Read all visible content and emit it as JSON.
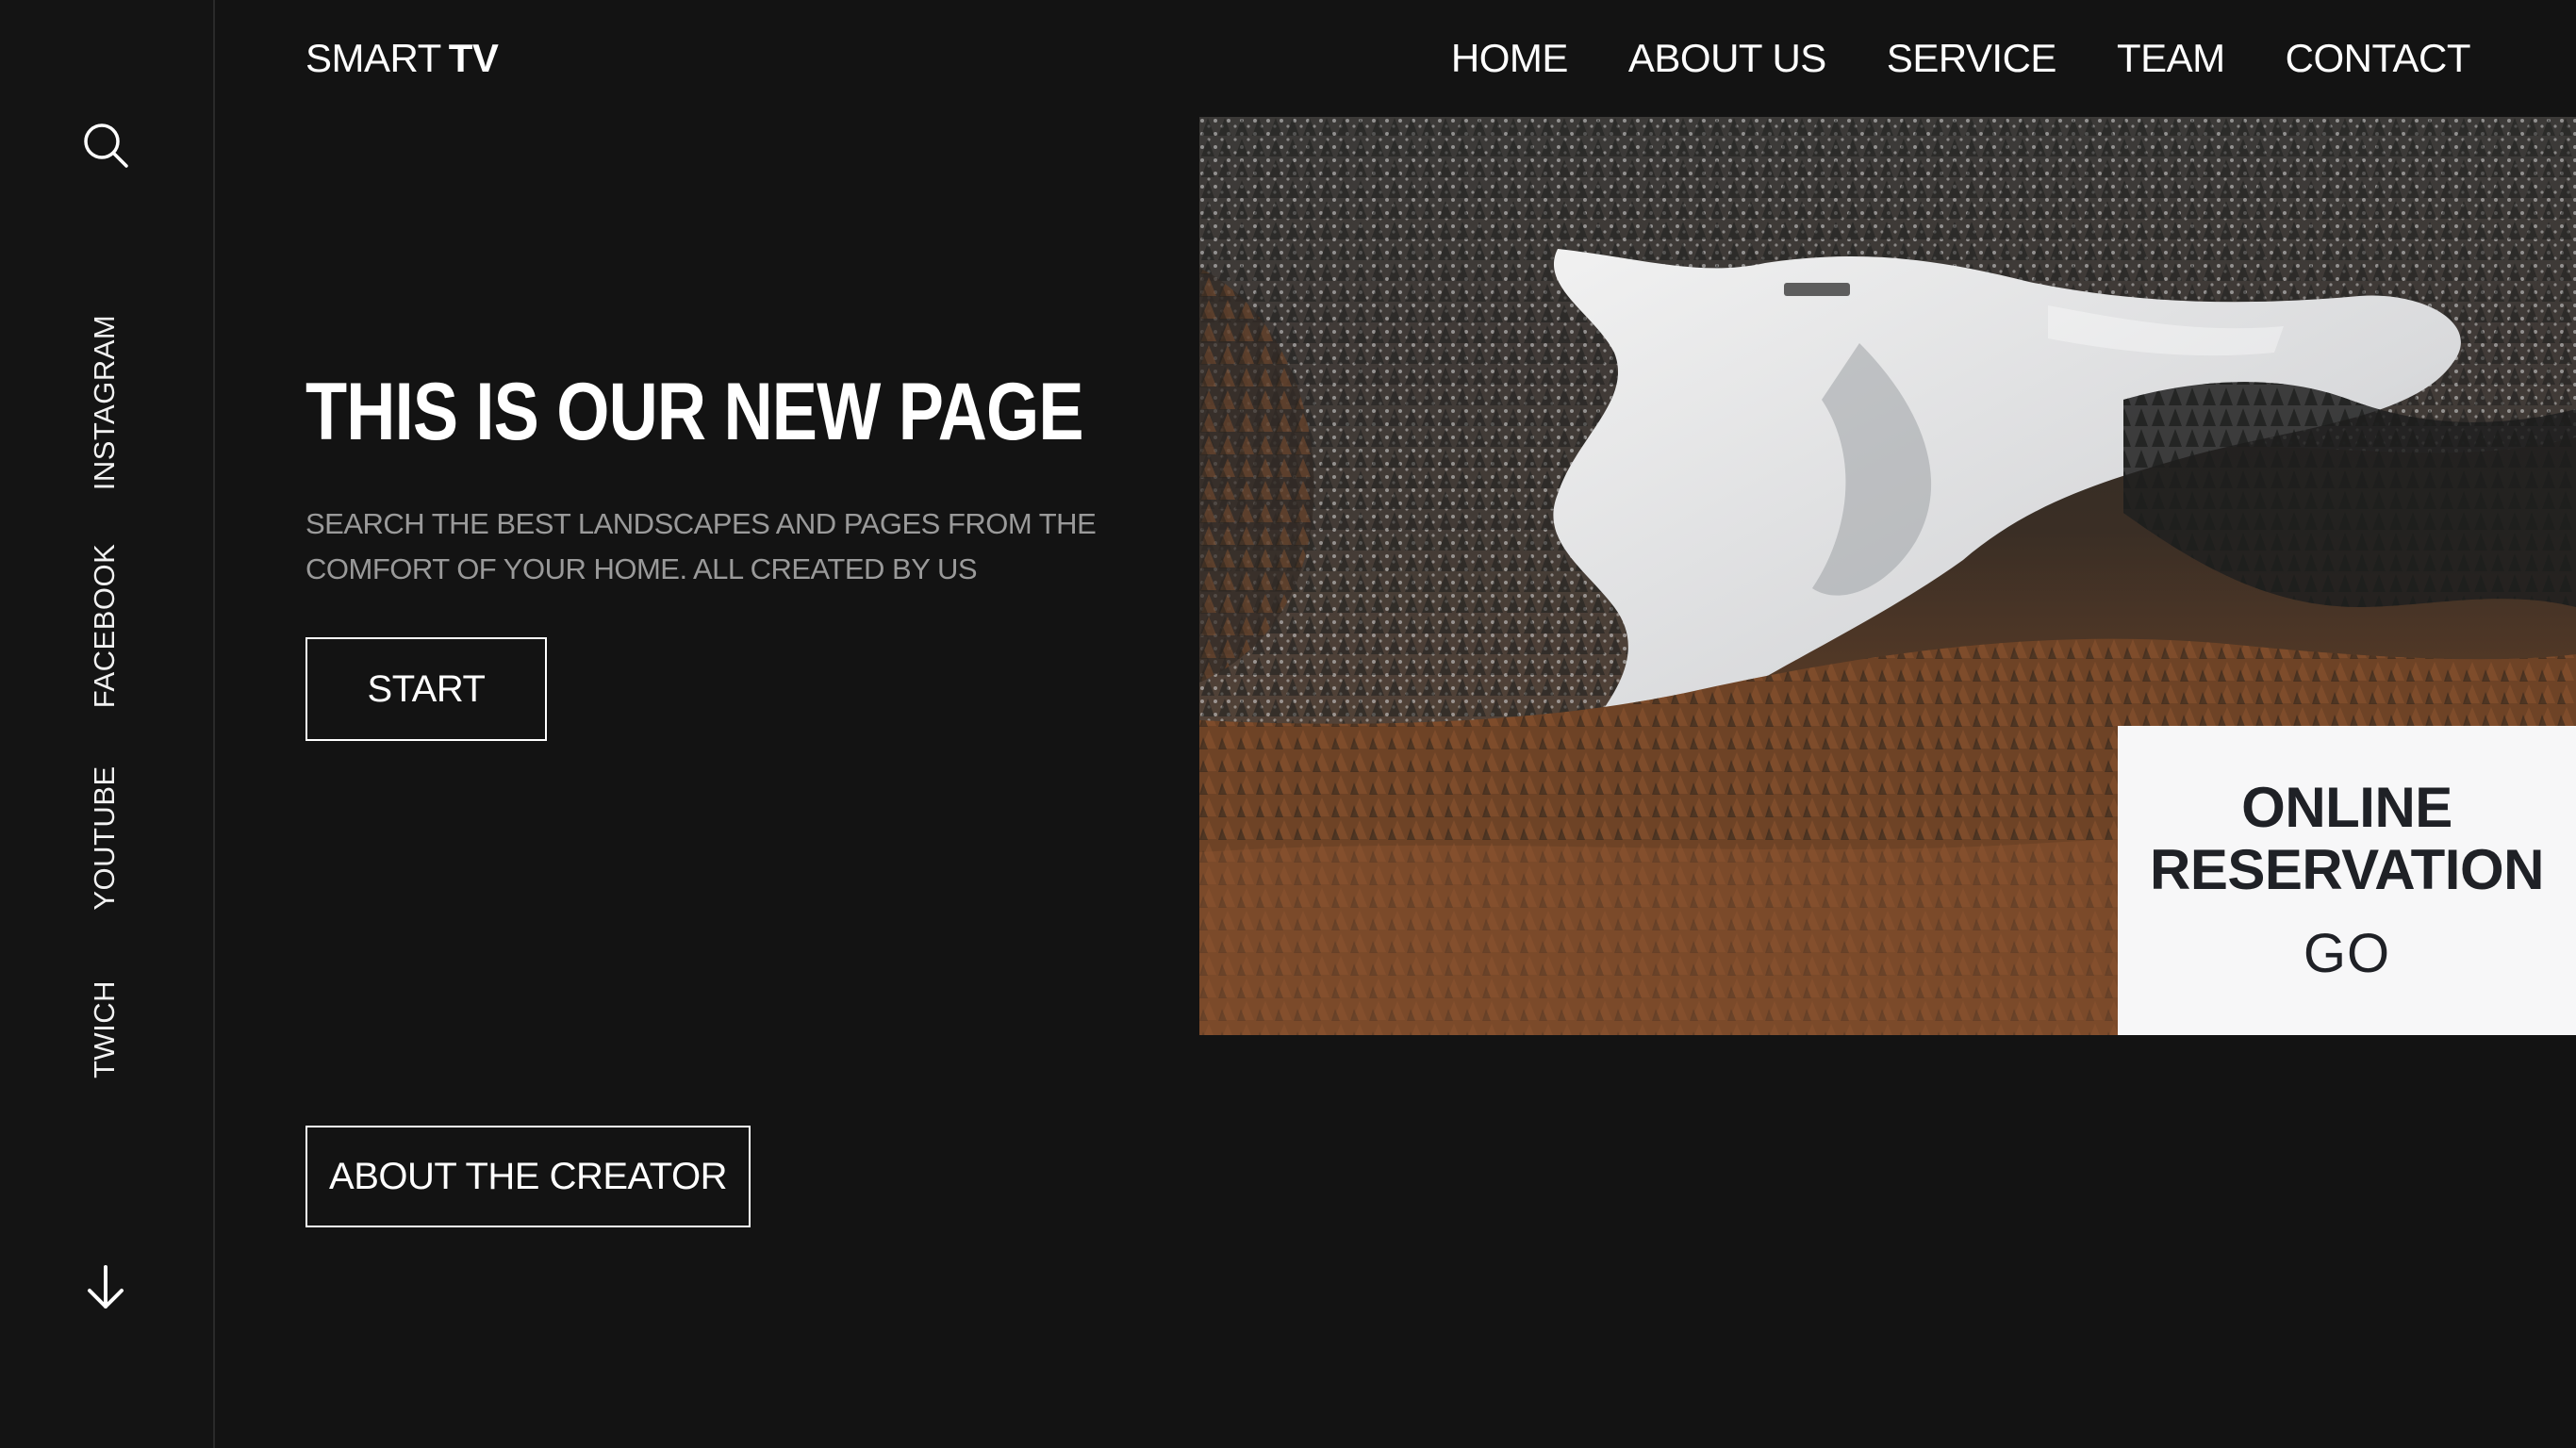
{
  "brand": {
    "light": "SMART",
    "bold": "TV"
  },
  "nav": {
    "items": [
      "HOME",
      "ABOUT US",
      "SERVICE",
      "TEAM",
      "CONTACT"
    ]
  },
  "sidebar": {
    "social": [
      "INSTAGRAM",
      "FACEBOOK",
      "YOUTUBE",
      "TWICH"
    ],
    "search_icon": "search-icon",
    "scroll_icon": "arrow-down-icon"
  },
  "hero": {
    "title": "THIS IS OUR NEW PAGE",
    "subtitle": "SEARCH THE BEST LANDSCAPES AND PAGES FROM THE COMFORT OF YOUR HOME. ALL CREATED BY US",
    "start_label": "START",
    "about_label": "ABOUT THE CREATOR"
  },
  "reservation": {
    "title_line1": "ONLINE",
    "title_line2": "RESERVATION",
    "go_label": "GO"
  },
  "colors": {
    "background": "#131313",
    "text": "#ffffff",
    "muted": "#9a9a9a",
    "card": "#f7f7f8"
  }
}
